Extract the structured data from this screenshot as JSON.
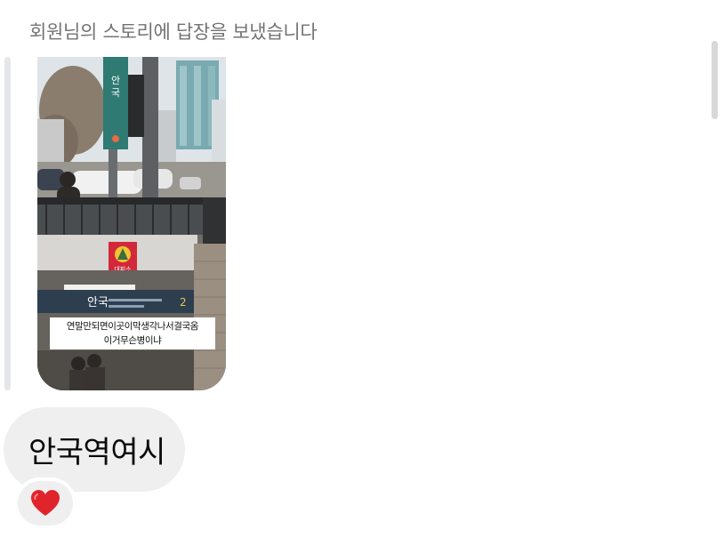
{
  "header": {
    "reply_notice": "회원님의 스토리에 답장을 보냈습니다"
  },
  "story": {
    "station_sign_name": "안국",
    "shelter_sign_label": "대피소",
    "caption_lines": [
      "연말만되면이곳이막생각나서결국옴",
      "이거무슨병이냐"
    ]
  },
  "message": {
    "text": "안국역여시"
  },
  "reaction": {
    "icon": "heart-icon",
    "color": "#e0242b"
  }
}
